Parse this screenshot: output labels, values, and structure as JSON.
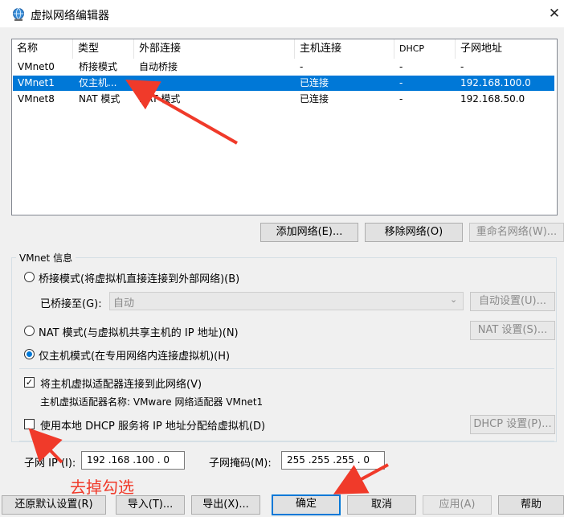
{
  "window": {
    "title": "虚拟网络编辑器",
    "close_glyph": "✕"
  },
  "netlist": {
    "columns": [
      "名称",
      "类型",
      "外部连接",
      "主机连接",
      "DHCP",
      "子网地址"
    ],
    "rows": [
      {
        "name": "VMnet0",
        "type": "桥接模式",
        "external": "自动桥接",
        "host": "-",
        "dhcp": "-",
        "subnet": "-"
      },
      {
        "name": "VMnet1",
        "type": "仅主机...",
        "external": "-",
        "host": "已连接",
        "dhcp": "-",
        "subnet": "192.168.100.0"
      },
      {
        "name": "VMnet8",
        "type": "NAT 模式",
        "external": "NAT 模式",
        "host": "已连接",
        "dhcp": "-",
        "subnet": "192.168.50.0"
      }
    ],
    "selected_row": 1
  },
  "net_buttons": {
    "add": "添加网络(E)...",
    "remove": "移除网络(O)",
    "rename": "重命名网络(W)..."
  },
  "vmnet_info": {
    "title": "VMnet 信息",
    "bridged_label": "桥接模式(将虚拟机直接连接到外部网络)(B)",
    "bridged_to_label": "已桥接至(G):",
    "bridged_to_value": "自动",
    "auto_settings": "自动设置(U)...",
    "nat_label": "NAT 模式(与虚拟机共享主机的 IP 地址)(N)",
    "nat_settings": "NAT 设置(S)...",
    "hostonly_label": "仅主机模式(在专用网络内连接虚拟机)(H)",
    "connect_adapter_label": "将主机虚拟适配器连接到此网络(V)",
    "adapter_name_label": "主机虚拟适配器名称: VMware 网络适配器 VMnet1",
    "dhcp_label": "使用本地 DHCP 服务将 IP 地址分配给虚拟机(D)",
    "dhcp_settings": "DHCP 设置(P)...",
    "subnet_ip_label": "子网 IP (I):",
    "subnet_ip_value": "192 .168 .100 .  0",
    "subnet_mask_label": "子网掩码(M):",
    "subnet_mask_value": "255 .255 .255 .  0",
    "mode_selected": "hostonly",
    "connect_adapter_checked": true,
    "dhcp_checked": false
  },
  "bottom_buttons": {
    "restore": "还原默认设置(R)",
    "import": "导入(T)...",
    "export": "导出(X)...",
    "ok": "确定",
    "cancel": "取消",
    "apply": "应用(A)",
    "help": "帮助"
  },
  "annotation": {
    "text": "去掉勾选",
    "color": "#f03a2a"
  },
  "colors": {
    "selection": "#0078d7",
    "arrow": "#f03a2a"
  }
}
